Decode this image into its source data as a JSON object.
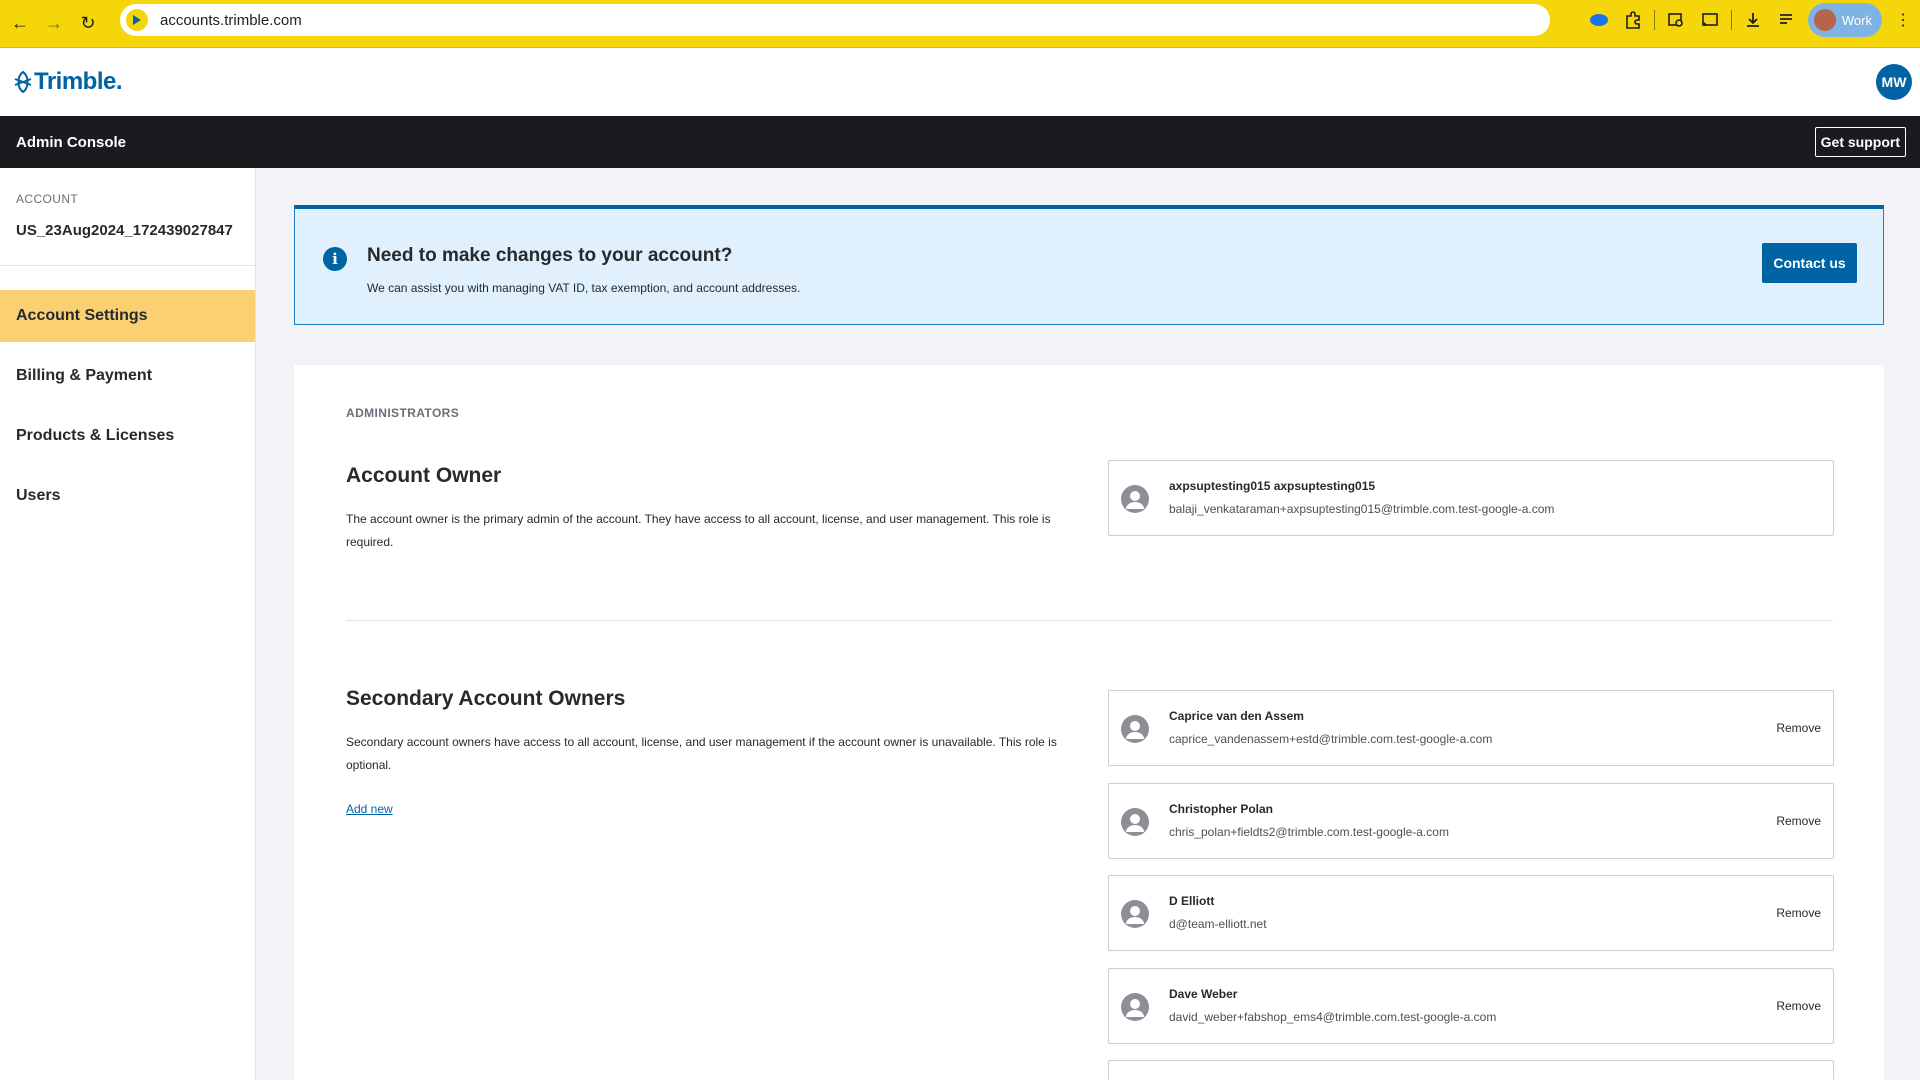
{
  "browser": {
    "url": "accounts.trimble.com",
    "profile_label": "Work"
  },
  "header": {
    "logo_text": "Trimble.",
    "avatar_initials": "MW"
  },
  "console_bar": {
    "title": "Admin Console",
    "support_label": "Get support"
  },
  "sidebar": {
    "account_label": "ACCOUNT",
    "account_name": "US_23Aug2024_172439027847",
    "items": [
      {
        "label": "Account Settings",
        "active": true
      },
      {
        "label": "Billing & Payment",
        "active": false
      },
      {
        "label": "Products & Licenses",
        "active": false
      },
      {
        "label": "Users",
        "active": false
      }
    ]
  },
  "banner": {
    "title": "Need to make changes to your account?",
    "text": "We can assist you with managing VAT ID, tax exemption, and account addresses.",
    "button_label": "Contact us"
  },
  "administrators": {
    "kicker": "ADMINISTRATORS",
    "owner": {
      "title": "Account Owner",
      "description": "The account owner is the primary admin of the account. They have access to all account, license, and user management. This role is required.",
      "person": {
        "name": "axpsuptesting015 axpsuptesting015",
        "email": "balaji_venkataraman+axpsuptesting015@trimble.com.test-google-a.com"
      }
    },
    "secondary": {
      "title": "Secondary Account Owners",
      "description": "Secondary account owners have access to all account, license, and user management if the account owner is unavailable. This role is optional.",
      "add_label": "Add new",
      "remove_label": "Remove",
      "people": [
        {
          "name": "Caprice van den Assem",
          "email": "caprice_vandenassem+estd@trimble.com.test-google-a.com"
        },
        {
          "name": "Christopher Polan",
          "email": "chris_polan+fieldts2@trimble.com.test-google-a.com"
        },
        {
          "name": "D Elliott",
          "email": "d@team-elliott.net"
        },
        {
          "name": "Dave Weber",
          "email": "david_weber+fabshop_ems4@trimble.com.test-google-a.com"
        }
      ]
    }
  }
}
